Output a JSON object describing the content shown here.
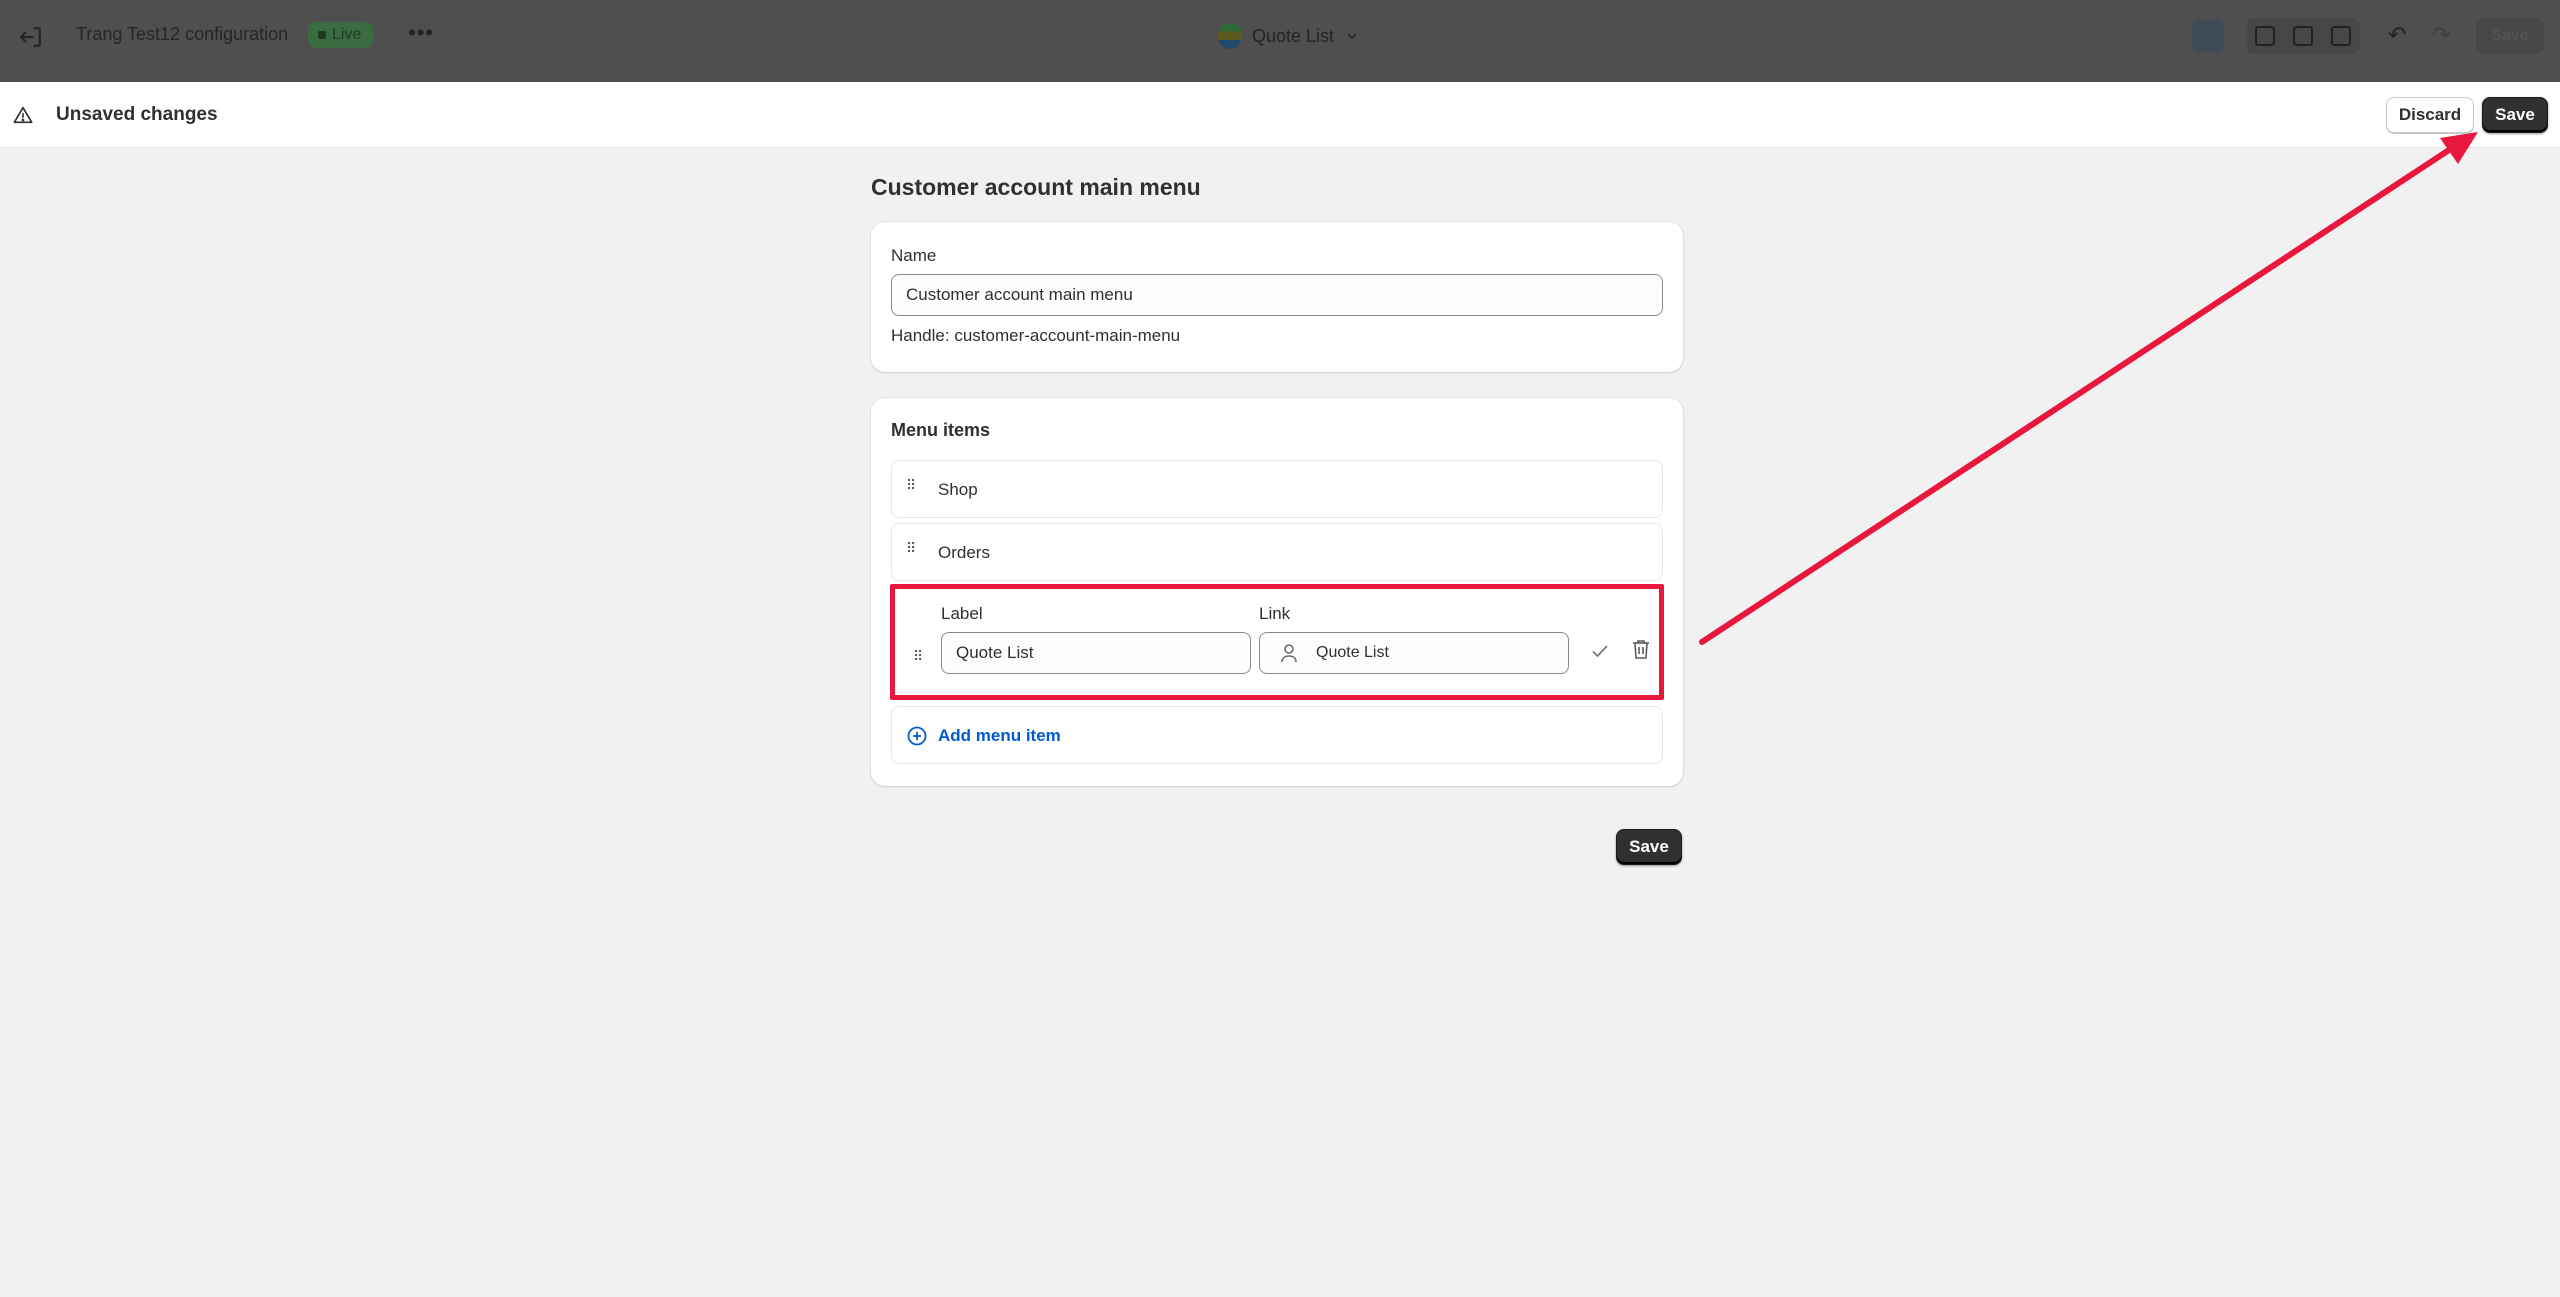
{
  "topbar": {
    "store_title": "Trang Test12 configuration",
    "status_badge": "Live",
    "more_label": "•••",
    "page_selector": "Quote List",
    "save_label": "Save"
  },
  "unsaved_bar": {
    "title": "Unsaved changes",
    "discard_label": "Discard",
    "save_label": "Save"
  },
  "main": {
    "page_title": "Customer account main menu",
    "name_card": {
      "name_label": "Name",
      "name_value": "Customer account main menu",
      "handle_text": "Handle: customer-account-main-menu"
    },
    "menu_card": {
      "heading": "Menu items",
      "items": [
        {
          "label": "Shop"
        },
        {
          "label": "Orders"
        }
      ],
      "editing_item": {
        "label_field_label": "Label",
        "label_value": "Quote List",
        "link_field_label": "Link",
        "link_value": "Quote List"
      },
      "add_item_label": "Add menu item"
    },
    "bottom_save_label": "Save"
  },
  "colors": {
    "annotation": "#e8173e",
    "primary_button": "#303030",
    "link_blue": "#005bd3"
  }
}
